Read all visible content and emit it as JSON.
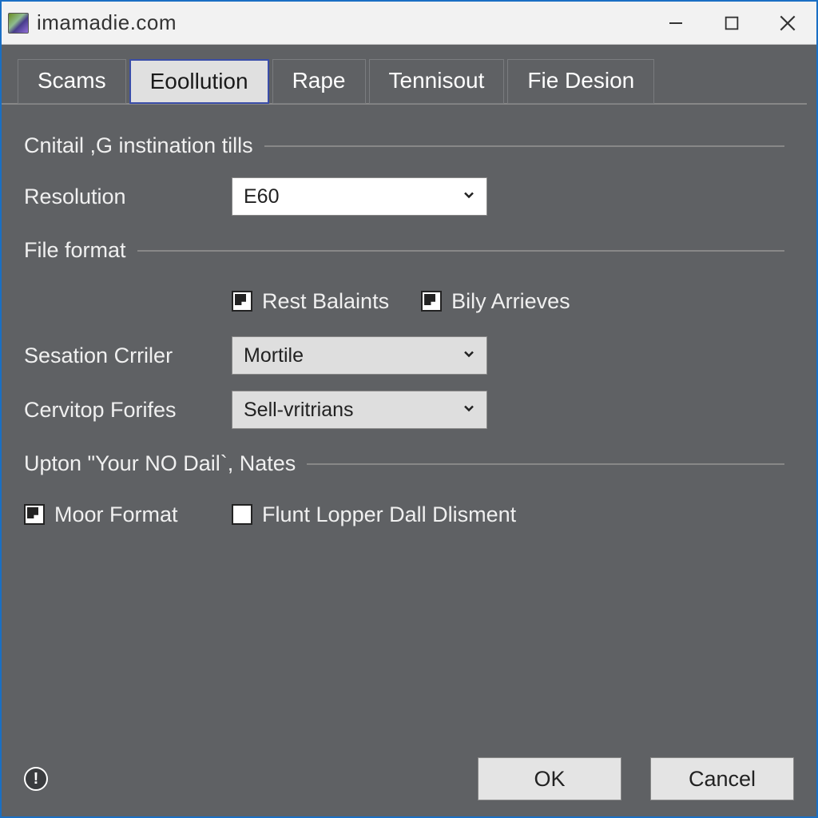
{
  "window": {
    "title": "imamadie.com"
  },
  "tabs": [
    "Scams",
    "Eoollution",
    "Rape",
    "Tennisout",
    "Fie Desion"
  ],
  "active_tab_index": 1,
  "sections": {
    "s1": {
      "header": "Cnitail ,G instination tills"
    },
    "s2": {
      "header": "File format"
    },
    "s3": {
      "header": "Upton \"Your NO Dail`, Nates"
    }
  },
  "fields": {
    "resolution": {
      "label": "Resolution",
      "value": "E60"
    },
    "rest_balaints": {
      "label": "Rest Balaints"
    },
    "bily_arrieves": {
      "label": "Bily Arrieves"
    },
    "sesation": {
      "label": "Sesation Crriler",
      "value": "Mortile"
    },
    "cervitop": {
      "label": "Cervitop Forifes",
      "value": "Sell-vritrians"
    },
    "moor_format": {
      "label": "Moor Format"
    },
    "flunt_lopper": {
      "label": "Flunt Lopper Dall Dlisment"
    }
  },
  "buttons": {
    "ok": "OK",
    "cancel": "Cancel"
  },
  "info_glyph": "!"
}
